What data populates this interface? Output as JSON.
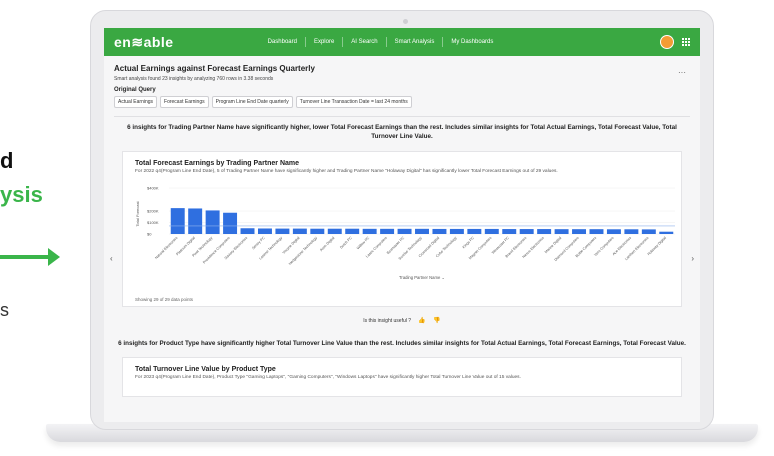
{
  "side": {
    "line1": "d",
    "line2": "ysis",
    "line3": "s"
  },
  "app": {
    "logo": "en≋able",
    "nav": [
      "Dashboard",
      "Explore",
      "AI Search",
      "Smart Analysis",
      "My Dashboards"
    ]
  },
  "page": {
    "title": "Actual Earnings against Forecast Earnings Quarterly",
    "menu": "···",
    "meta": "Smart analysis found 23 insights by analyzing 760 rows in 3.38 seconds",
    "original_query_label": "Original Query",
    "query_chips": [
      "Actual Earnings",
      "Forecast Earnings",
      "Program Line End Date quarterly",
      "Turnover Line Transaction Date = last 24 months"
    ]
  },
  "insight1": {
    "headline": "6 insights for Trading Partner Name have significantly higher, lower Total Forecast Earnings than the rest. Includes similar insights for Total Actual Earnings, Total Forecast Value, Total Turnover Line Value.",
    "card_title": "Total Forecast Earnings by Trading Partner Name",
    "card_sub": "For 2022 q4(Program Line End Date), 5 of Trading Partner Name have significantly higher and Trading Partner Name \"Holaway Digital\" has significantly lower Total Forecast Earnings out of 29 values.",
    "showing": "Showing 29 of 29 data points",
    "useful_label": "Is this insight useful ?",
    "thumb_up": "👍",
    "thumb_down": "👎"
  },
  "insight2": {
    "headline": "6 insights for Product Type have significantly higher Total Turnover Line Value than the rest. Includes similar insights for Total Actual Earnings, Total Forecast Earnings, Total Forecast Value.",
    "card_title": "Total Turnover Line Value by Product Type",
    "card_sub": "For 2023 q4(Program Line End Date), Product Type \"Gaming Laptops\", \"Gaming Computers\", \"Windows Laptops\" have significantly higher Total Turnover Line Value out of 15 values."
  },
  "nav_arrows": {
    "left": "‹",
    "right": "›"
  },
  "chart_data": {
    "type": "bar",
    "title": "Total Forecast Earnings by Trading Partner Name",
    "xlabel": "Trading Partner Name",
    "ylabel": "Total Forecast",
    "ylim": [
      0,
      400000
    ],
    "yticks": [
      "$0",
      "$100K",
      "$200K",
      "$400K"
    ],
    "bar_color": "#2f6fe0",
    "categories": [
      "Natural Electronics",
      "Platinum Digital",
      "Pixel Technology",
      "Providence Computers",
      "Saviory Electronics",
      "Sentry PC",
      "Lasene Technology",
      "Vocyne Digital",
      "Hedgestone Technology",
      "Avon Digital",
      "Dutch PC",
      "Willow PC",
      "Lasec Computers",
      "Boxmaster PC",
      "Sunrise Technology",
      "Crossroad Digital",
      "Cube Technology",
      "Kings PC",
      "Magnet Computers",
      "Westcoast PC",
      "Brand Electronics",
      "Nexus Electronics",
      "Marine Digital",
      "Diamond Computers",
      "Bottle Computers",
      "Vero Computers",
      "Ace Electronics",
      "Lambert Electronics",
      "Holaway Digital"
    ],
    "values": [
      225000,
      222000,
      205000,
      185000,
      50000,
      48000,
      47000,
      47000,
      46000,
      46000,
      46000,
      45000,
      45000,
      45000,
      45000,
      44000,
      44000,
      44000,
      44000,
      43000,
      43000,
      43000,
      42000,
      42000,
      42000,
      41000,
      41000,
      40000,
      20000
    ],
    "average": 70000
  }
}
